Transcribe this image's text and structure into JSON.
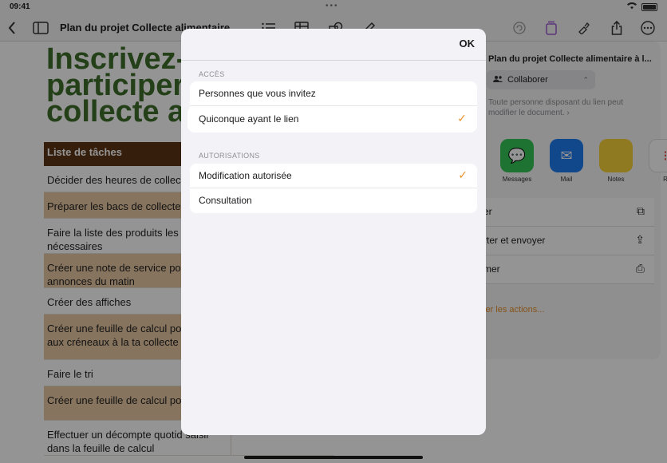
{
  "status": {
    "time": "09:41"
  },
  "toolbar": {
    "title": "Plan du projet Collecte alimentaire"
  },
  "document": {
    "heading_lines": [
      "Inscrivez-v",
      "participer",
      "collecte al"
    ],
    "task_header": "Liste de tâches",
    "tasks": [
      {
        "text": "Décider des heures de collec",
        "alt": false
      },
      {
        "text": "Préparer les bacs de collecte",
        "alt": true
      },
      {
        "text": "Faire la liste des produits les p nécessaires",
        "alt": false
      },
      {
        "text": "Créer une note de service po annonces du matin",
        "alt": true
      },
      {
        "text": "Créer des affiches",
        "alt": false
      },
      {
        "text": "Créer une feuille de calcul po s'inscrire aux créneaux à la ta collecte",
        "alt": true
      },
      {
        "text": "Faire le tri",
        "alt": false
      },
      {
        "text": "Créer une feuille de calcul po des dons",
        "alt": true
      },
      {
        "text": "Effectuer un décompte quotid saisir dans la feuille de calcul",
        "alt": false
      }
    ]
  },
  "share_panel": {
    "title": "Plan du projet Collecte alimentaire à l...",
    "collab_label": "Collaborer",
    "description": "Toute personne disposant du lien peut modifier le document.",
    "apps": [
      {
        "label": "Messages",
        "color": "#34c759",
        "icon": "message-icon"
      },
      {
        "label": "Mail",
        "color": "#1e7cf2",
        "icon": "mail-icon"
      },
      {
        "label": "Notes",
        "color": "#f7d33b",
        "icon": "notes-icon"
      },
      {
        "label": "R",
        "color": "#ffffff",
        "icon": "reminders-icon"
      }
    ],
    "actions": [
      {
        "label": "er",
        "icon": "copy-icon"
      },
      {
        "label": "rter et envoyer",
        "icon": "export-icon"
      },
      {
        "label": "mer",
        "icon": "print-icon"
      }
    ],
    "edit_actions_label": "ier les actions..."
  },
  "modal": {
    "ok_label": "OK",
    "access_section": "ACCÈS",
    "access_options": [
      {
        "label": "Personnes que vous invitez",
        "selected": false
      },
      {
        "label": "Quiconque ayant le lien",
        "selected": true
      }
    ],
    "permissions_section": "AUTORISATIONS",
    "permission_options": [
      {
        "label": "Modification autorisée",
        "selected": true
      },
      {
        "label": "Consultation",
        "selected": false
      }
    ],
    "check_glyph": "✓"
  }
}
